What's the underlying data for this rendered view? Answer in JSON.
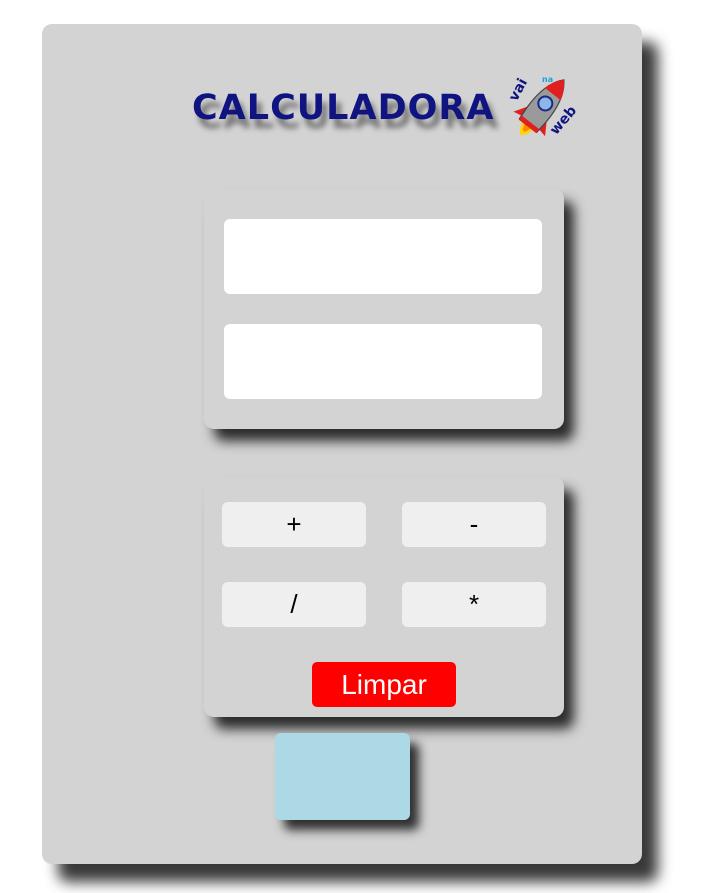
{
  "header": {
    "title": "CALCULADORA",
    "logo": {
      "icon": "rocket-icon",
      "text_top": "vai",
      "text_mid": "na",
      "text_bottom": "web"
    }
  },
  "inputs": {
    "first_value": "",
    "second_value": ""
  },
  "operations": {
    "add_label": "+",
    "subtract_label": "-",
    "divide_label": "/",
    "multiply_label": "*",
    "clear_label": "Limpar"
  },
  "result": {
    "value": ""
  },
  "colors": {
    "card": "#d3d3d3",
    "title": "#0f1480",
    "clear_button": "#ff0000",
    "result_box": "#add8e6"
  }
}
